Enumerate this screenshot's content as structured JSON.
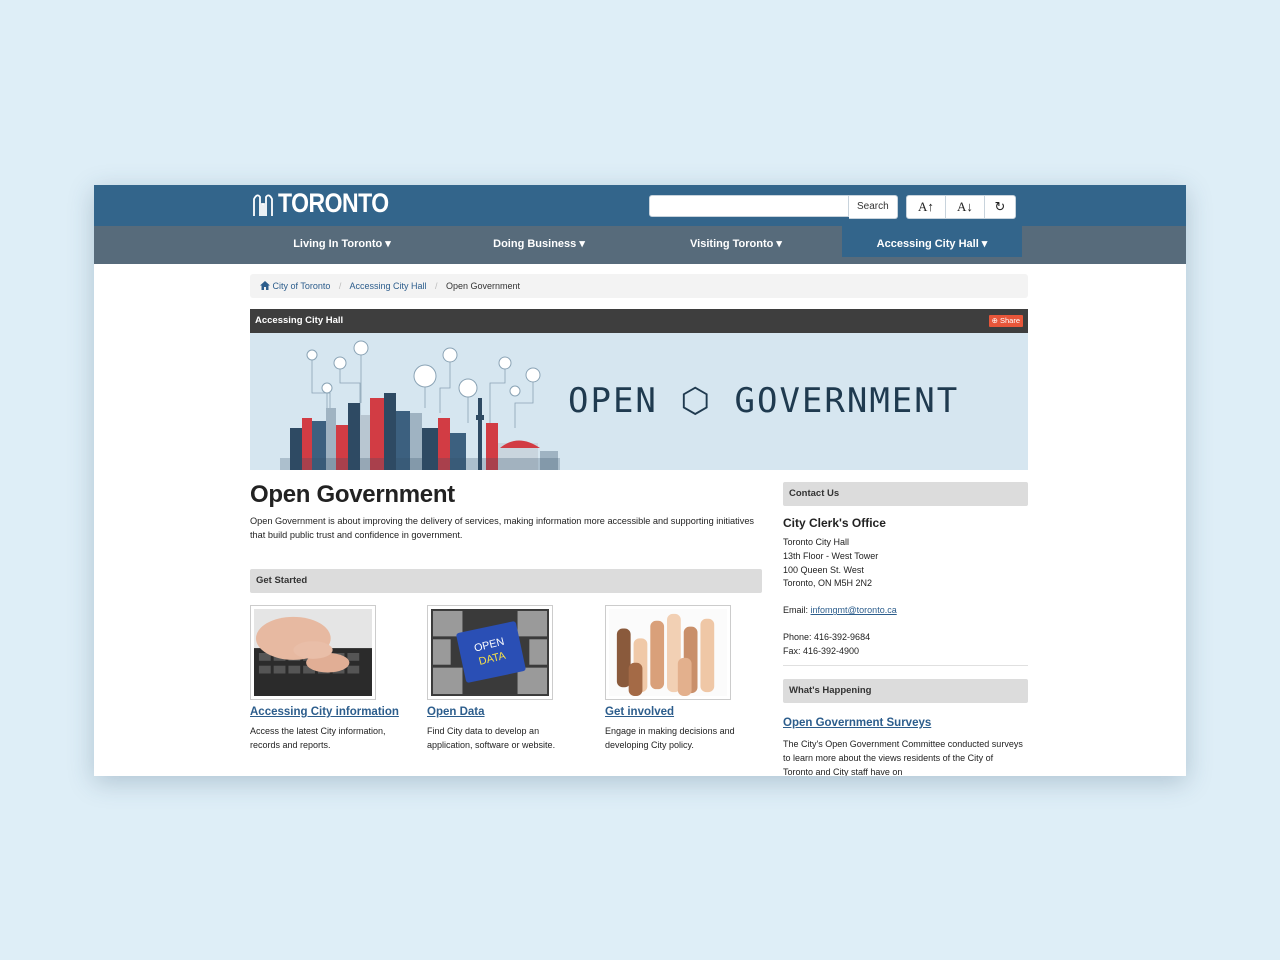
{
  "header": {
    "logo_text": "TORONTO",
    "search_placeholder": "",
    "search_button": "Search",
    "font_increase": "A↑",
    "font_decrease": "A↓",
    "reset_icon": "↻"
  },
  "nav": {
    "items": [
      {
        "label": "Living In Toronto ▾"
      },
      {
        "label": "Doing Business ▾"
      },
      {
        "label": "Visiting Toronto ▾"
      },
      {
        "label": "Accessing City Hall ▾"
      }
    ]
  },
  "breadcrumb": {
    "items": [
      "City of Toronto",
      "Accessing City Hall",
      "Open Government"
    ]
  },
  "section": {
    "title": "Accessing City Hall",
    "share": "Share"
  },
  "banner": {
    "title": "OPEN ⬡ GOVERNMENT"
  },
  "main": {
    "title": "Open Government",
    "intro": "Open Government is about improving the delivery of services, making information more accessible and supporting initiatives that build public trust and confidence in government.",
    "get_started": "Get Started",
    "cards": [
      {
        "link": "Accessing City information",
        "desc": "Access the latest City information, records and reports."
      },
      {
        "link": "Open Data",
        "desc": "Find City data to develop an application, software or website.",
        "key_label_1": "OPEN",
        "key_label_2": "DATA"
      },
      {
        "link": "Get involved",
        "desc": "Engage in making decisions and developing City policy."
      }
    ]
  },
  "sidebar": {
    "contact_heading": "Contact Us",
    "office": "City Clerk's Office",
    "address": [
      "Toronto City Hall",
      "13th Floor - West Tower",
      "100 Queen St. West",
      "Toronto, ON M5H 2N2"
    ],
    "email_label": "Email:",
    "email": "infomgmt@toronto.ca",
    "phone": "Phone: 416-392-9684",
    "fax": "Fax: 416-392-4900",
    "happening_heading": "What's Happening",
    "happening_link": "Open Government Surveys",
    "happening_text": "The City's Open Government Committee conducted surveys to learn more about the views residents of the City of Toronto and City staff have on"
  },
  "colors": {
    "header_blue": "#33658b",
    "nav_grey": "#576b7b",
    "link_blue": "#2c5d8c",
    "share_orange": "#e8563a"
  }
}
